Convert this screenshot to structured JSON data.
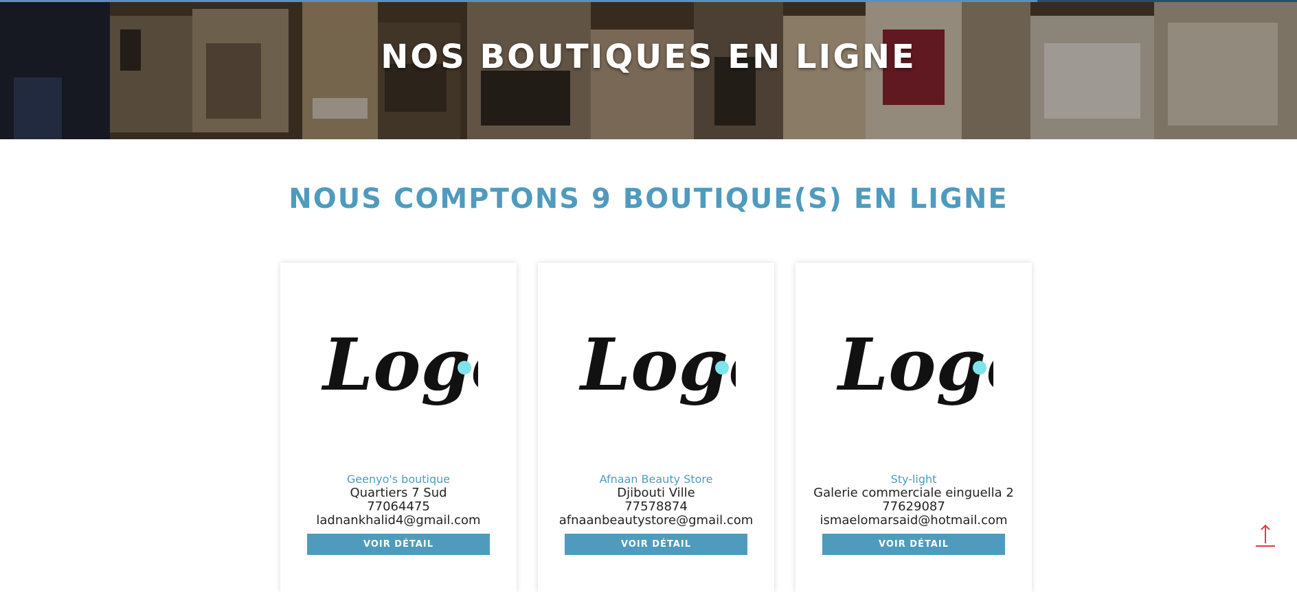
{
  "page": {
    "hero_title": "NOS BOUTIQUES EN LIGNE",
    "count_heading": "NOUS COMPTONS 9 BOUTIQUE(S) EN LIGNE",
    "top_progress_percent": 80
  },
  "logo_text": "Logo",
  "stores": [
    {
      "name": "Geenyo's boutique",
      "address": "Quartiers 7 Sud",
      "phone": "77064475",
      "email": "ladnankhalid4@gmail.com",
      "button_label": "VOIR DÉTAIL"
    },
    {
      "name": "Afnaan Beauty Store",
      "address": "Djibouti Ville",
      "phone": "77578874",
      "email": "afnaanbeautystore@gmail.com",
      "button_label": "VOIR DÉTAIL"
    },
    {
      "name": "Sty-light",
      "address": "Galerie commerciale einguella 2",
      "phone": "77629087",
      "email": "ismaelomarsaid@hotmail.com",
      "button_label": "VOIR DÉTAIL"
    }
  ],
  "colors": {
    "accent": "#4f9bbd",
    "logo_dot": "#7fe3ee",
    "scroll_top_arrow": "#e53935",
    "top_bar": "#2b4d6d"
  },
  "icons": {
    "scroll_top": "arrow-up-icon",
    "store_logo": "logo-image"
  }
}
